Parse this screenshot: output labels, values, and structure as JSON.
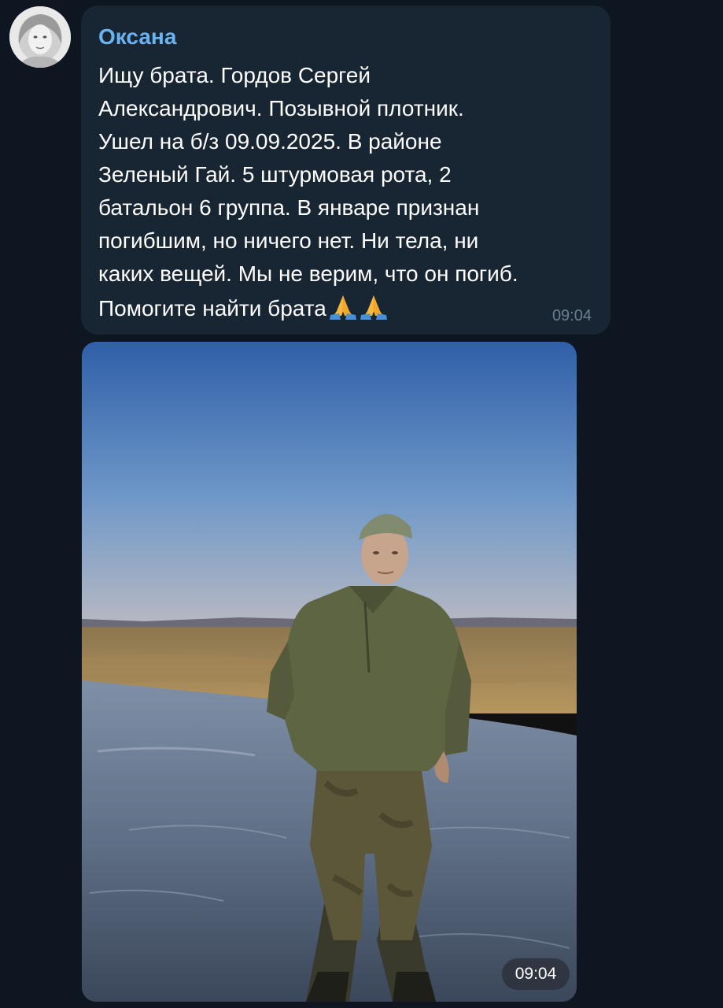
{
  "message": {
    "sender": "Оксана",
    "lines": [
      "Ищу брата. Гордов Сергей",
      "Александрович. Позывной плотник.",
      "Ушел на б/з 09.09.2025. В районе",
      "Зеленый Гай.  5 штурмовая рота, 2",
      "батальон 6 группа. В январе признан",
      "погибшим, но ничего нет. Ни тела, ни",
      "каких вещей. Мы не верим, что он погиб.",
      "Помогите найти брата"
    ],
    "emoji": "🙏🙏",
    "time": "09:04",
    "accent_color": "#6ab3f3"
  },
  "photo_message": {
    "time": "09:04"
  },
  "icons": {
    "avatar": "sender-avatar",
    "emoji": "folded-hands-icon"
  }
}
